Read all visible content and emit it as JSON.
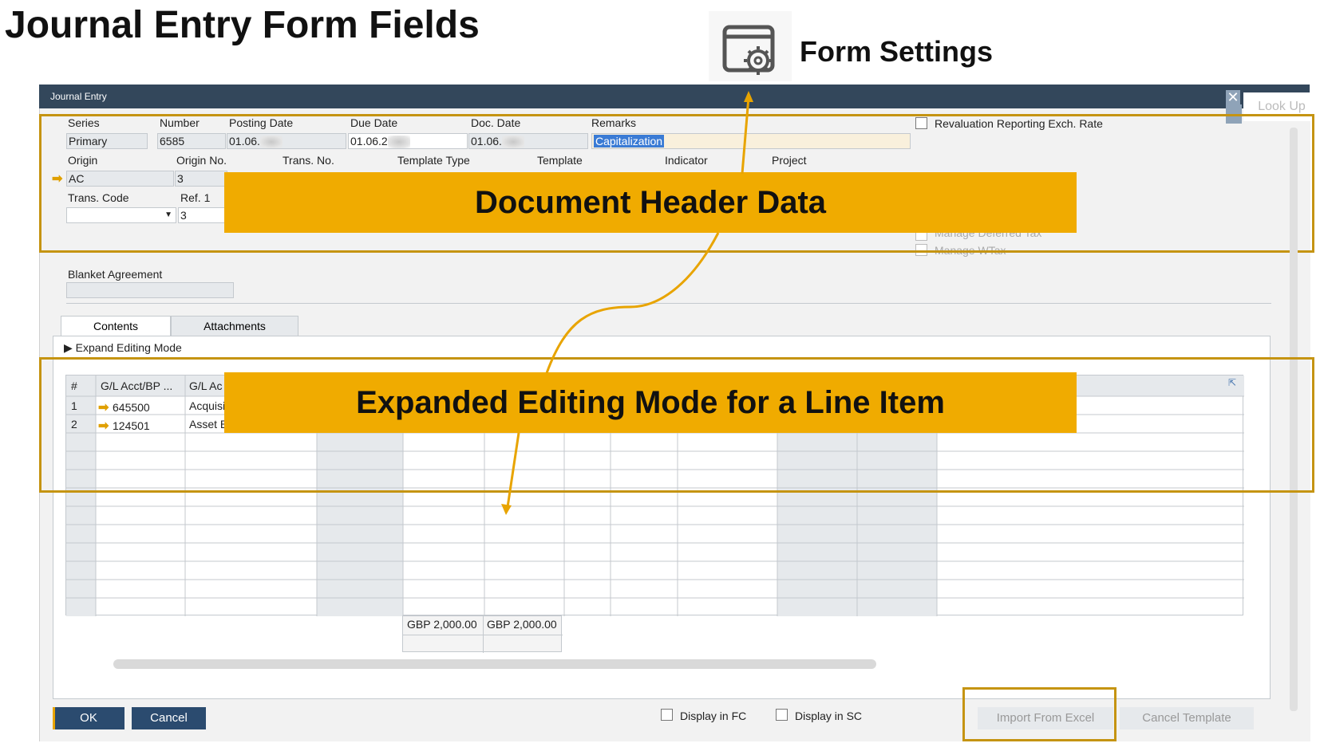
{
  "slide": {
    "title": "Journal Entry Form Fields",
    "form_settings_label": "Form Settings",
    "banner_header": "Document Header Data",
    "banner_lines": "Expanded Editing Mode for a Line Item"
  },
  "window": {
    "title": "Journal Entry",
    "lookup_label": "Look Up"
  },
  "header": {
    "series_label": "Series",
    "series_value": "Primary",
    "number_label": "Number",
    "number_value": "6585",
    "posting_date_label": "Posting Date",
    "posting_date_value": "01.06.",
    "due_date_label": "Due Date",
    "due_date_value": "01.06.2",
    "doc_date_label": "Doc. Date",
    "doc_date_value": "01.06.",
    "remarks_label": "Remarks",
    "remarks_value": "Capitalization",
    "revaluation_label": "Revaluation Reporting Exch. Rate",
    "origin_label": "Origin",
    "origin_value": "AC",
    "origin_no_label": "Origin No.",
    "origin_no_value": "3",
    "trans_no_label": "Trans. No.",
    "template_type_label": "Template Type",
    "template_label": "Template",
    "indicator_label": "Indicator",
    "project_label": "Project",
    "trans_code_label": "Trans. Code",
    "ref1_label": "Ref. 1",
    "ref1_value": "3",
    "deferred_tax_label": "Manage Deferred Tax",
    "wtax_label": "Manage WTax",
    "blanket_label": "Blanket Agreement"
  },
  "tabs": [
    "Contents",
    "Attachments"
  ],
  "expand_label": "Expand Editing Mode",
  "grid": {
    "columns": [
      "#",
      "G/L Acct/BP ...",
      "G/L Ac"
    ],
    "rows": [
      {
        "num": "1",
        "account": "645500",
        "name": "Acquisit"
      },
      {
        "num": "2",
        "account": "124501",
        "name": "Asset B"
      }
    ],
    "total_debit": "GBP 2,000.00",
    "total_credit": "GBP 2,000.00"
  },
  "footer": {
    "ok": "OK",
    "cancel": "Cancel",
    "display_fc": "Display in FC",
    "display_sc": "Display in SC",
    "import_excel": "Import From Excel",
    "cancel_template": "Cancel Template"
  },
  "colors": {
    "titlebar": "#33475b",
    "highlight_orange": "#f0ab00",
    "box_orange": "#c59412",
    "button_blue": "#2b4b6f"
  }
}
